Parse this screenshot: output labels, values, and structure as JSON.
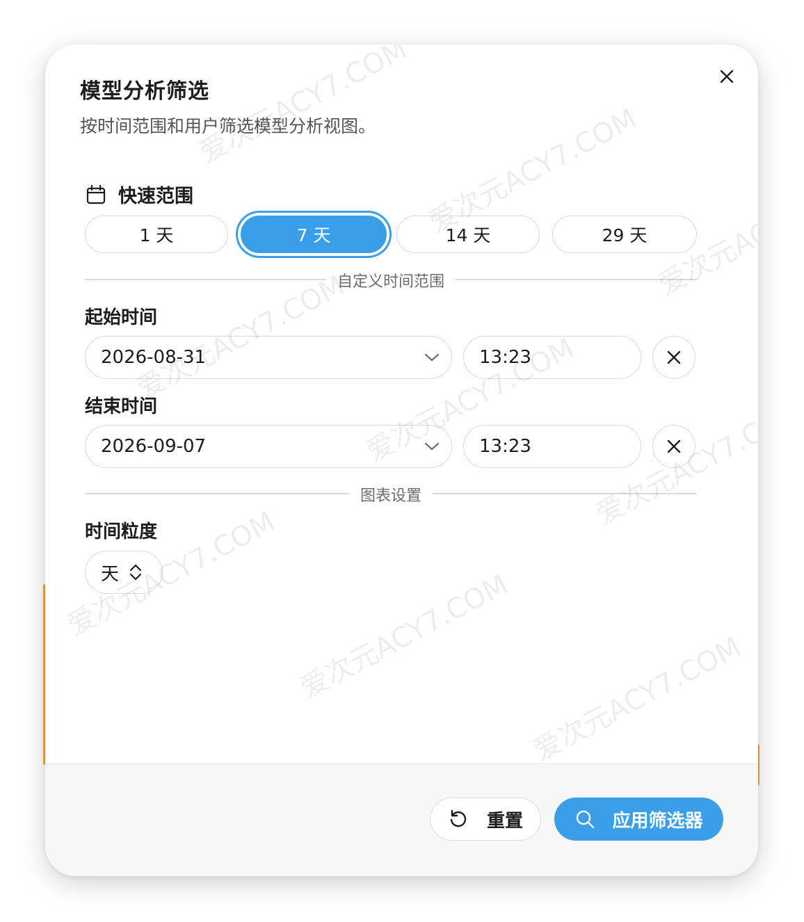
{
  "dialog": {
    "title": "模型分析筛选",
    "subtitle": "按时间范围和用户筛选模型分析视图。",
    "close_icon": "close-icon"
  },
  "quick_range": {
    "label": "快速范围",
    "icon": "calendar-icon",
    "options": [
      "1 天",
      "7 天",
      "14 天",
      "29 天"
    ],
    "selected": "7 天"
  },
  "custom_range": {
    "divider_label": "自定义时间范围",
    "start": {
      "label": "起始时间",
      "date": "2026-08-31",
      "time": "13:23"
    },
    "end": {
      "label": "结束时间",
      "date": "2026-09-07",
      "time": "13:23"
    }
  },
  "chart_settings": {
    "divider_label": "图表设置",
    "granularity_label": "时间粒度",
    "granularity_value": "天"
  },
  "footer": {
    "reset_label": "重置",
    "reset_icon": "reset-icon",
    "apply_label": "应用筛选器",
    "apply_icon": "search-icon"
  },
  "watermark_text": "爱次元ACY7.COM",
  "colors": {
    "accent": "#3b9ee8",
    "border": "#dadade",
    "footer_bg": "#f7f7f8"
  }
}
